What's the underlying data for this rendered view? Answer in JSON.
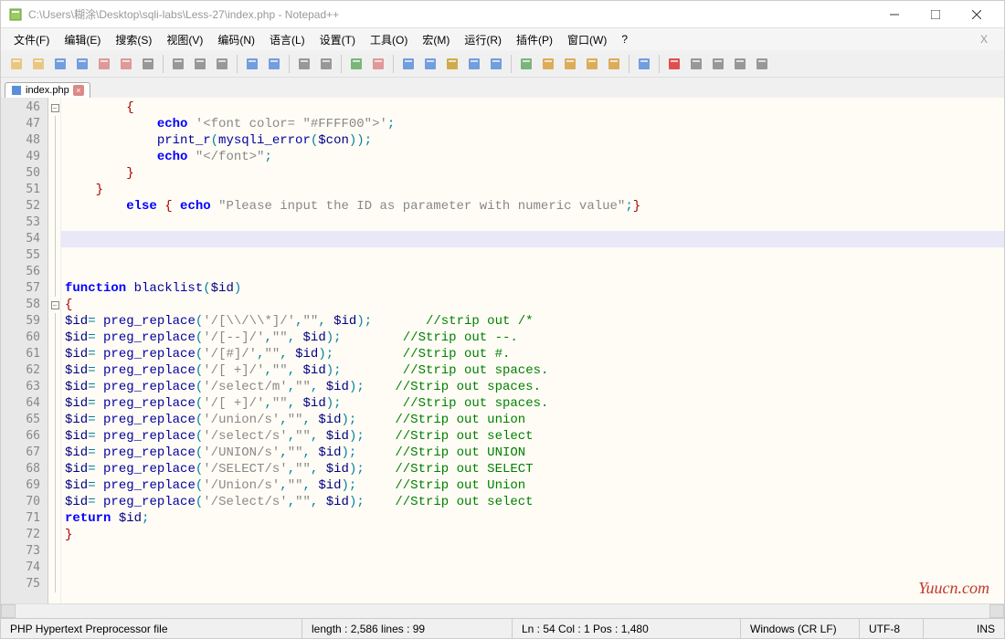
{
  "title": "C:\\Users\\糊涂\\Desktop\\sqli-labs\\Less-27\\index.php - Notepad++",
  "menus": [
    "文件(F)",
    "编辑(E)",
    "搜索(S)",
    "视图(V)",
    "编码(N)",
    "语言(L)",
    "设置(T)",
    "工具(O)",
    "宏(M)",
    "运行(R)",
    "插件(P)",
    "窗口(W)",
    "?"
  ],
  "tab": {
    "label": "index.php"
  },
  "lines": {
    "start": 46,
    "rows": [
      {
        "n": 46,
        "fold": "box",
        "html": "        <span class='brace'>{</span>"
      },
      {
        "n": 47,
        "html": "            <span class='kw2'>echo</span> <span class='str'>'&lt;font color= \"#FFFF00\"&gt;'</span><span class='op'>;</span>"
      },
      {
        "n": 48,
        "html": "            <span class='fn'>print_r</span><span class='op'>(</span><span class='fn'>mysqli_error</span><span class='op'>(</span><span class='var'>$con</span><span class='op'>));</span>"
      },
      {
        "n": 49,
        "html": "            <span class='kw2'>echo</span> <span class='str'>\"&lt;/font&gt;\"</span><span class='op'>;</span>"
      },
      {
        "n": 50,
        "html": "        <span class='brace'>}</span>"
      },
      {
        "n": 51,
        "html": "    <span class='brace'>}</span>"
      },
      {
        "n": 52,
        "html": "        <span class='kw2'>else</span> <span class='brace'>{</span> <span class='kw2'>echo</span> <span class='str'>\"Please input the ID as parameter with numeric value\"</span><span class='op'>;</span><span class='brace'>}</span>"
      },
      {
        "n": 53,
        "html": ""
      },
      {
        "n": 54,
        "hl": true,
        "html": ""
      },
      {
        "n": 55,
        "html": ""
      },
      {
        "n": 56,
        "html": ""
      },
      {
        "n": 57,
        "html": "<span class='kw2'>function</span> <span class='fn'>blacklist</span><span class='op'>(</span><span class='var'>$id</span><span class='op'>)</span>"
      },
      {
        "n": 58,
        "fold": "box",
        "html": "<span class='brace'>{</span>"
      },
      {
        "n": 59,
        "html": "<span class='var'>$id</span><span class='op'>=</span> <span class='fn'>preg_replace</span><span class='op'>(</span><span class='str'>'/[\\\\/\\\\*]/'</span><span class='op'>,</span><span class='str'>\"\"</span><span class='op'>,</span> <span class='var'>$id</span><span class='op'>);</span>       <span class='cmt'>//strip out /*</span>"
      },
      {
        "n": 60,
        "html": "<span class='var'>$id</span><span class='op'>=</span> <span class='fn'>preg_replace</span><span class='op'>(</span><span class='str'>'/[--]/'</span><span class='op'>,</span><span class='str'>\"\"</span><span class='op'>,</span> <span class='var'>$id</span><span class='op'>);</span>        <span class='cmt'>//Strip out --.</span>"
      },
      {
        "n": 61,
        "html": "<span class='var'>$id</span><span class='op'>=</span> <span class='fn'>preg_replace</span><span class='op'>(</span><span class='str'>'/[#]/'</span><span class='op'>,</span><span class='str'>\"\"</span><span class='op'>,</span> <span class='var'>$id</span><span class='op'>);</span>         <span class='cmt'>//Strip out #.</span>"
      },
      {
        "n": 62,
        "html": "<span class='var'>$id</span><span class='op'>=</span> <span class='fn'>preg_replace</span><span class='op'>(</span><span class='str'>'/[ +]/'</span><span class='op'>,</span><span class='str'>\"\"</span><span class='op'>,</span> <span class='var'>$id</span><span class='op'>);</span>        <span class='cmt'>//Strip out spaces.</span>"
      },
      {
        "n": 63,
        "html": "<span class='var'>$id</span><span class='op'>=</span> <span class='fn'>preg_replace</span><span class='op'>(</span><span class='str'>'/select/m'</span><span class='op'>,</span><span class='str'>\"\"</span><span class='op'>,</span> <span class='var'>$id</span><span class='op'>);</span>    <span class='cmt'>//Strip out spaces.</span>"
      },
      {
        "n": 64,
        "html": "<span class='var'>$id</span><span class='op'>=</span> <span class='fn'>preg_replace</span><span class='op'>(</span><span class='str'>'/[ +]/'</span><span class='op'>,</span><span class='str'>\"\"</span><span class='op'>,</span> <span class='var'>$id</span><span class='op'>);</span>        <span class='cmt'>//Strip out spaces.</span>"
      },
      {
        "n": 65,
        "html": "<span class='var'>$id</span><span class='op'>=</span> <span class='fn'>preg_replace</span><span class='op'>(</span><span class='str'>'/union/s'</span><span class='op'>,</span><span class='str'>\"\"</span><span class='op'>,</span> <span class='var'>$id</span><span class='op'>);</span>     <span class='cmt'>//Strip out union</span>"
      },
      {
        "n": 66,
        "html": "<span class='var'>$id</span><span class='op'>=</span> <span class='fn'>preg_replace</span><span class='op'>(</span><span class='str'>'/select/s'</span><span class='op'>,</span><span class='str'>\"\"</span><span class='op'>,</span> <span class='var'>$id</span><span class='op'>);</span>    <span class='cmt'>//Strip out select</span>"
      },
      {
        "n": 67,
        "html": "<span class='var'>$id</span><span class='op'>=</span> <span class='fn'>preg_replace</span><span class='op'>(</span><span class='str'>'/UNION/s'</span><span class='op'>,</span><span class='str'>\"\"</span><span class='op'>,</span> <span class='var'>$id</span><span class='op'>);</span>     <span class='cmt'>//Strip out UNION</span>"
      },
      {
        "n": 68,
        "html": "<span class='var'>$id</span><span class='op'>=</span> <span class='fn'>preg_replace</span><span class='op'>(</span><span class='str'>'/SELECT/s'</span><span class='op'>,</span><span class='str'>\"\"</span><span class='op'>,</span> <span class='var'>$id</span><span class='op'>);</span>    <span class='cmt'>//Strip out SELECT</span>"
      },
      {
        "n": 69,
        "html": "<span class='var'>$id</span><span class='op'>=</span> <span class='fn'>preg_replace</span><span class='op'>(</span><span class='str'>'/Union/s'</span><span class='op'>,</span><span class='str'>\"\"</span><span class='op'>,</span> <span class='var'>$id</span><span class='op'>);</span>     <span class='cmt'>//Strip out Union</span>"
      },
      {
        "n": 70,
        "html": "<span class='var'>$id</span><span class='op'>=</span> <span class='fn'>preg_replace</span><span class='op'>(</span><span class='str'>'/Select/s'</span><span class='op'>,</span><span class='str'>\"\"</span><span class='op'>,</span> <span class='var'>$id</span><span class='op'>);</span>    <span class='cmt'>//Strip out select</span>"
      },
      {
        "n": 71,
        "html": "<span class='kw2'>return</span> <span class='var'>$id</span><span class='op'>;</span>"
      },
      {
        "n": 72,
        "html": "<span class='brace'>}</span>"
      },
      {
        "n": 73,
        "html": ""
      },
      {
        "n": 74,
        "html": ""
      },
      {
        "n": 75,
        "html": ""
      }
    ]
  },
  "status": {
    "filetype": "PHP Hypertext Preprocessor file",
    "length": "length : 2,586    lines : 99",
    "pos": "Ln : 54    Col : 1    Pos : 1,480",
    "eol": "Windows (CR LF)",
    "enc": "UTF-8",
    "ins": "INS"
  },
  "watermark": "Yuucn.com",
  "toolbar_icons": [
    {
      "name": "new-file-icon",
      "c": "#e8c070"
    },
    {
      "name": "open-file-icon",
      "c": "#e8c070"
    },
    {
      "name": "save-icon",
      "c": "#5a8fd8"
    },
    {
      "name": "save-all-icon",
      "c": "#5a8fd8"
    },
    {
      "name": "close-icon",
      "c": "#d88"
    },
    {
      "name": "close-all-icon",
      "c": "#d88"
    },
    {
      "name": "print-icon",
      "c": "#888"
    },
    {
      "sep": true
    },
    {
      "name": "cut-icon",
      "c": "#888"
    },
    {
      "name": "copy-icon",
      "c": "#888"
    },
    {
      "name": "paste-icon",
      "c": "#888"
    },
    {
      "sep": true
    },
    {
      "name": "undo-icon",
      "c": "#5a8fd8"
    },
    {
      "name": "redo-icon",
      "c": "#5a8fd8"
    },
    {
      "sep": true
    },
    {
      "name": "find-icon",
      "c": "#888"
    },
    {
      "name": "replace-icon",
      "c": "#888"
    },
    {
      "sep": true
    },
    {
      "name": "zoom-in-icon",
      "c": "#6a6"
    },
    {
      "name": "zoom-out-icon",
      "c": "#d88"
    },
    {
      "sep": true
    },
    {
      "name": "sync-v-icon",
      "c": "#5a8fd8"
    },
    {
      "name": "sync-h-icon",
      "c": "#5a8fd8"
    },
    {
      "name": "wrap-icon",
      "c": "#c8a030"
    },
    {
      "name": "all-chars-icon",
      "c": "#5a8fd8"
    },
    {
      "name": "indent-guide-icon",
      "c": "#5a8fd8"
    },
    {
      "sep": true
    },
    {
      "name": "lang-icon",
      "c": "#6a6"
    },
    {
      "name": "doc-map-icon",
      "c": "#d8a040"
    },
    {
      "name": "doc-list-icon",
      "c": "#d8a040"
    },
    {
      "name": "func-list-icon",
      "c": "#d8a040"
    },
    {
      "name": "folder-tree-icon",
      "c": "#d8a040"
    },
    {
      "sep": true
    },
    {
      "name": "monitor-icon",
      "c": "#5a8fd8"
    },
    {
      "sep": true
    },
    {
      "name": "record-macro-icon",
      "c": "#d33"
    },
    {
      "name": "stop-macro-icon",
      "c": "#888"
    },
    {
      "name": "play-macro-icon",
      "c": "#888"
    },
    {
      "name": "play-multi-icon",
      "c": "#888"
    },
    {
      "name": "save-macro-icon",
      "c": "#888"
    }
  ]
}
